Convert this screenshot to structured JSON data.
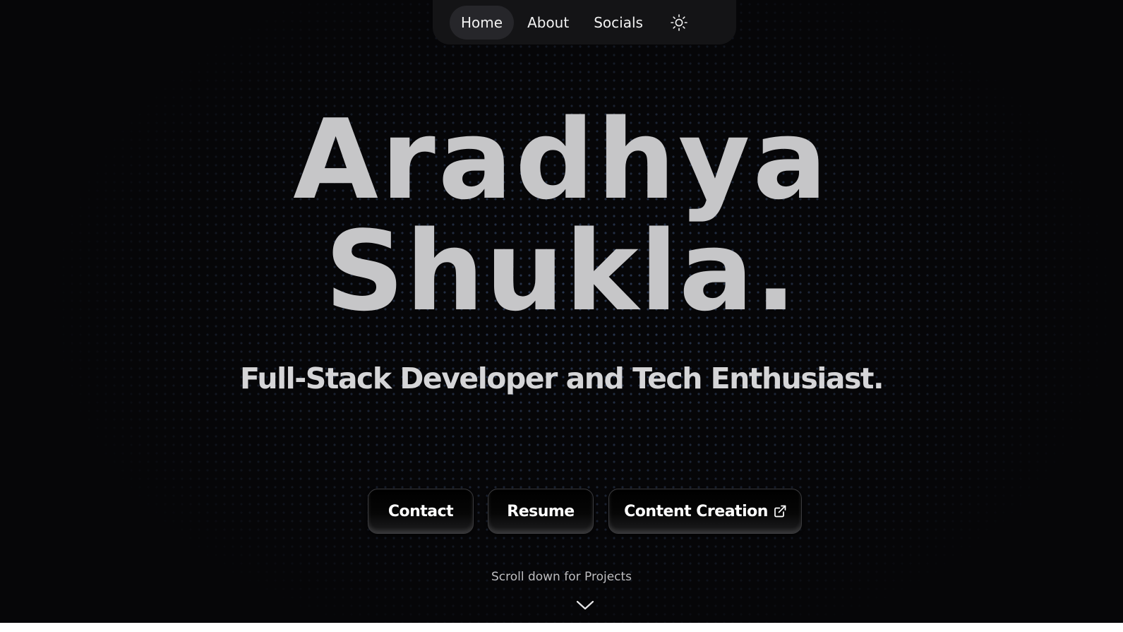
{
  "nav": {
    "items": [
      {
        "label": "Home",
        "active": true
      },
      {
        "label": "About",
        "active": false
      },
      {
        "label": "Socials",
        "active": false
      }
    ],
    "theme_toggle_icon": "sun-icon"
  },
  "hero": {
    "name_line_1": "Aradhya",
    "name_line_2": "Shukla.",
    "tagline": "Full-Stack Developer and Tech Enthusiast."
  },
  "actions": {
    "contact_label": "Contact",
    "resume_label": "Resume",
    "content_creation_label": "Content Creation",
    "content_creation_icon": "external-link-icon"
  },
  "scroll": {
    "hint": "Scroll down for Projects",
    "icon": "chevron-down-icon"
  },
  "colors": {
    "background": "#060608",
    "dot_pattern": "#6082be",
    "heading_text": "#c6c6c8",
    "nav_background": "#141416",
    "nav_active": "#26262a"
  }
}
